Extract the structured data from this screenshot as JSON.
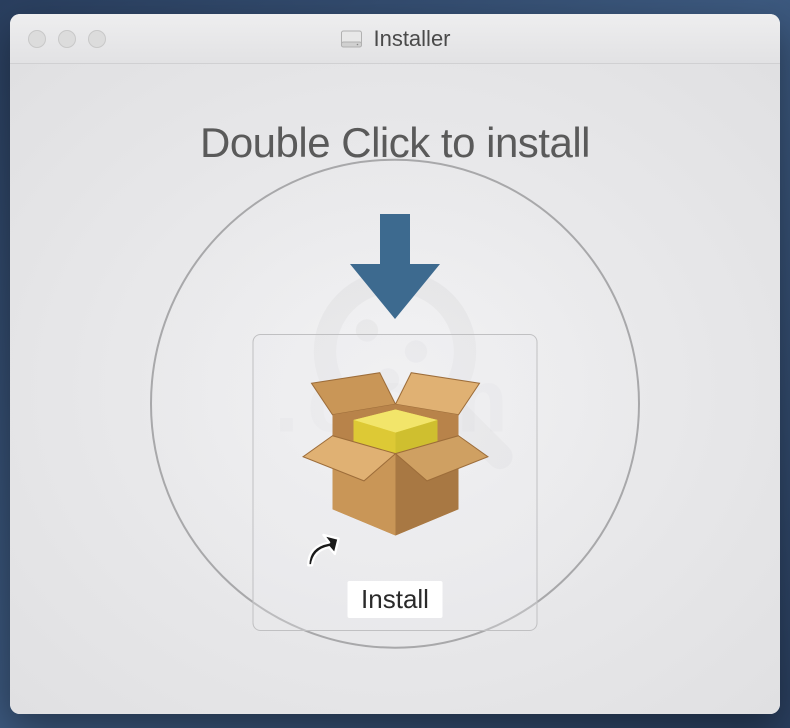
{
  "titlebar": {
    "title": "Installer"
  },
  "content": {
    "instruction": "Double Click to install",
    "install_label": "Install"
  },
  "colors": {
    "arrow": "#3d6a8f",
    "box_light": "#d4a25e",
    "box_dark": "#9d6d3a",
    "cube": "#e5d33a"
  }
}
